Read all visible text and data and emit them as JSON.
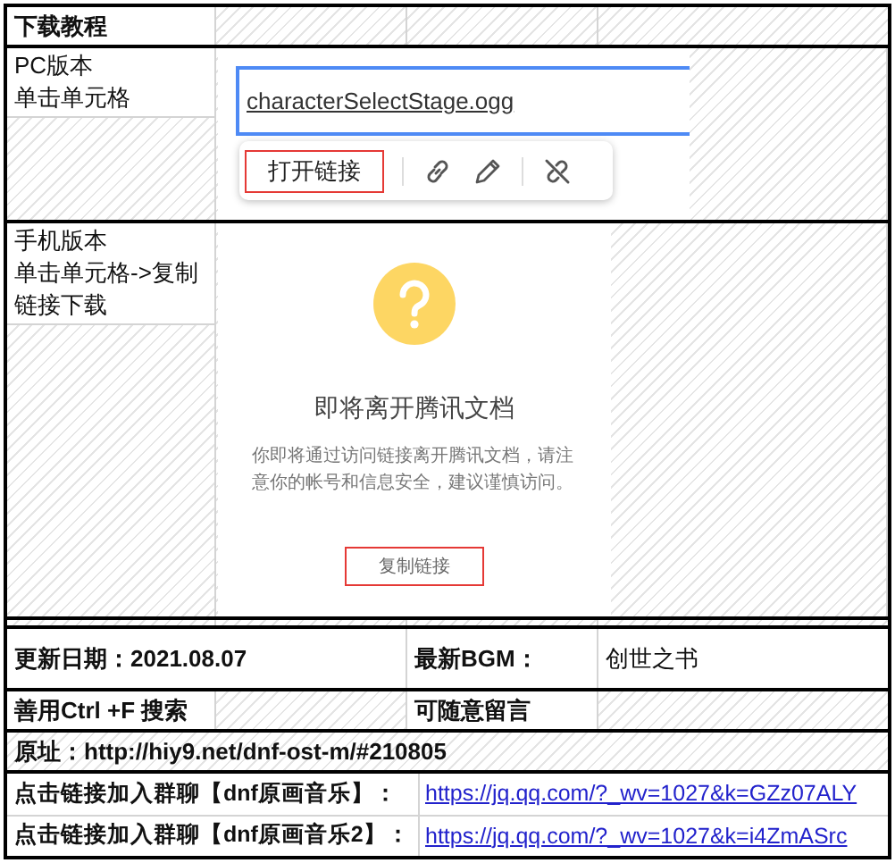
{
  "sheet": {
    "title": "下载教程",
    "pc": {
      "labels": [
        "PC版本",
        "单击单元格"
      ],
      "link": "characterSelectStage.ogg",
      "popup": {
        "button": "打开链接",
        "highlighted": true
      }
    },
    "mobile": {
      "labels": [
        "手机版本",
        "单击单元格->复制链接下载"
      ],
      "dialog": {
        "title": "即将离开腾讯文档",
        "message": "你即将通过访问链接离开腾讯文档，请注意你的帐号和信息安全，建议谨慎访问。",
        "button": "复制链接",
        "highlighted": true
      }
    },
    "info": {
      "date": "更新日期：2021.08.07",
      "bgm_label": "最新BGM：",
      "bgm": "创世之书",
      "search_tip": "善用Ctrl +F 搜索",
      "comment_tip": "可随意留言",
      "source": "原址：http://hiy9.net/dnf-ost-m/#210805"
    },
    "groups": [
      {
        "label": "点击链接加入群聊【dnf原画音乐】：",
        "url": "https://jq.qq.com/?_wv=1027&k=GZz07ALY"
      },
      {
        "label": "点击链接加入群聊【dnf原画音乐2】：",
        "url": "https://jq.qq.com/?_wv=1027&k=i4ZmASrc"
      }
    ]
  }
}
